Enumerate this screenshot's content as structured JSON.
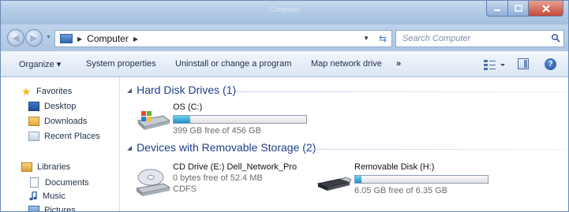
{
  "window": {
    "title": "Computer"
  },
  "address": {
    "path": "Computer",
    "search_placeholder": "Search Computer"
  },
  "toolbar": {
    "organize": "Organize ▾",
    "system_properties": "System properties",
    "uninstall": "Uninstall or change a program",
    "map_drive": "Map network drive",
    "more": "»"
  },
  "nav": {
    "favorites": "Favorites",
    "desktop": "Desktop",
    "downloads": "Downloads",
    "recent": "Recent Places",
    "libraries": "Libraries",
    "documents": "Documents",
    "music": "Music",
    "pictures": "Pictures"
  },
  "groups": {
    "hdd": "Hard Disk Drives (1)",
    "removable": "Devices with Removable Storage (2)"
  },
  "drives": {
    "os": {
      "name": "OS (C:)",
      "free": "399 GB free of 456 GB",
      "used_fraction": 0.125
    },
    "cd": {
      "name": "CD Drive (E:) Dell_Network_Pro",
      "free": "0 bytes free of 52.4 MB",
      "fs": "CDFS"
    },
    "removable": {
      "name": "Removable Disk (H:)",
      "free": "6.05 GB free of 6.35 GB",
      "used_fraction": 0.047
    }
  },
  "colors": {
    "accent": "#1e3f8a",
    "bar_fill": "#1b91c6"
  }
}
